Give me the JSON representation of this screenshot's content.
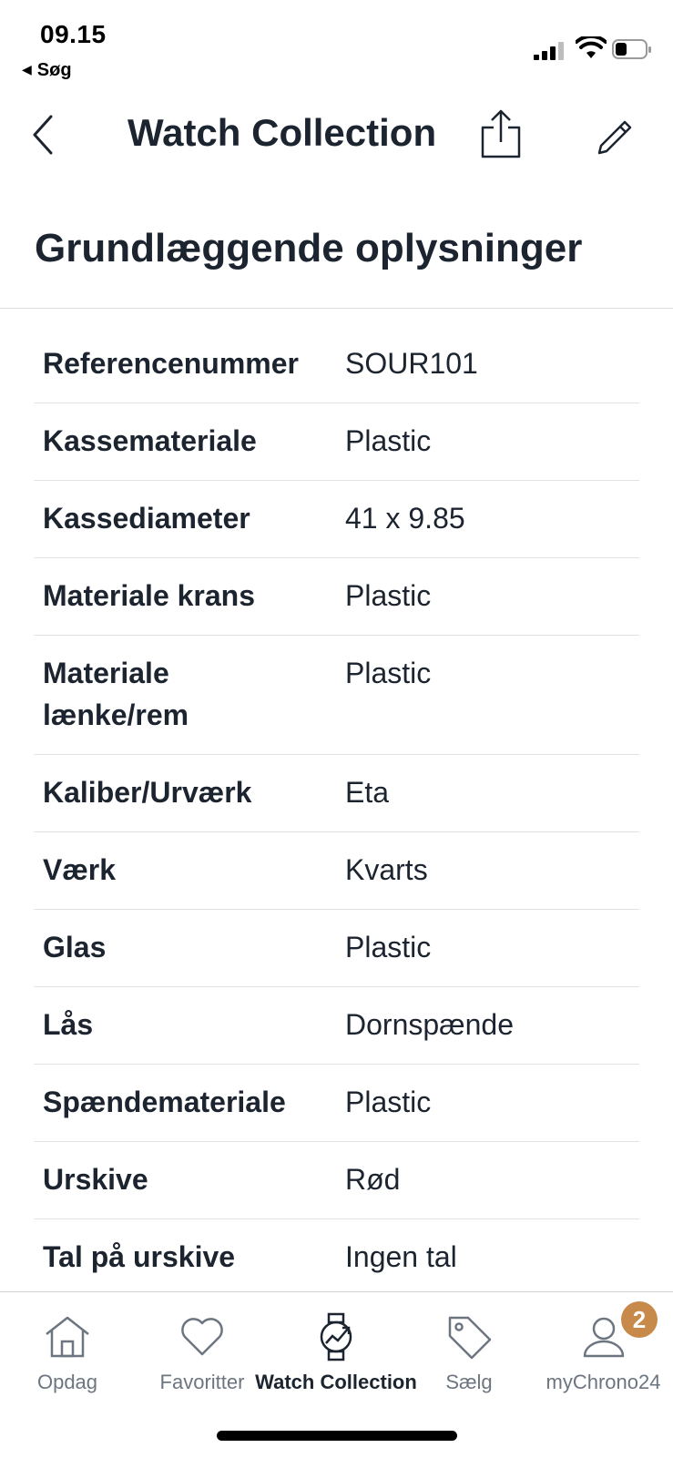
{
  "status_bar": {
    "time": "09.15",
    "back_app": "Søg",
    "back_glyph": "◀"
  },
  "navbar": {
    "title": "Watch Collection"
  },
  "section": {
    "title": "Grundlæggende oplysninger"
  },
  "details": [
    {
      "label": "Referencenummer",
      "value": "SOUR101"
    },
    {
      "label": "Kassemateriale",
      "value": "Plastic"
    },
    {
      "label": "Kassediameter",
      "value": "41 x 9.85"
    },
    {
      "label": "Materiale krans",
      "value": "Plastic"
    },
    {
      "label": "Materiale lænke/rem",
      "value": "Plastic"
    },
    {
      "label": "Kaliber/Urværk",
      "value": "Eta"
    },
    {
      "label": "Værk",
      "value": "Kvarts"
    },
    {
      "label": "Glas",
      "value": "Plastic"
    },
    {
      "label": "Lås",
      "value": "Dornspænde"
    },
    {
      "label": "Spændemateriale",
      "value": "Plastic"
    },
    {
      "label": "Urskive",
      "value": "Rød"
    },
    {
      "label": "Tal på urskive",
      "value": "Ingen tal"
    }
  ],
  "tabbar": {
    "tabs": [
      {
        "label": "Opdag",
        "icon": "home-icon",
        "active": false
      },
      {
        "label": "Favoritter",
        "icon": "heart-icon",
        "active": false
      },
      {
        "label": "Watch Collection",
        "icon": "watch-icon",
        "active": true
      },
      {
        "label": "Sælg",
        "icon": "tag-icon",
        "active": false
      },
      {
        "label": "myChrono24",
        "icon": "user-icon",
        "active": false,
        "badge": "2"
      }
    ]
  },
  "colors": {
    "text": "#1c2430",
    "tab_inactive": "#6d7580",
    "badge": "#c78a4a",
    "divider": "#e3e3e3"
  }
}
